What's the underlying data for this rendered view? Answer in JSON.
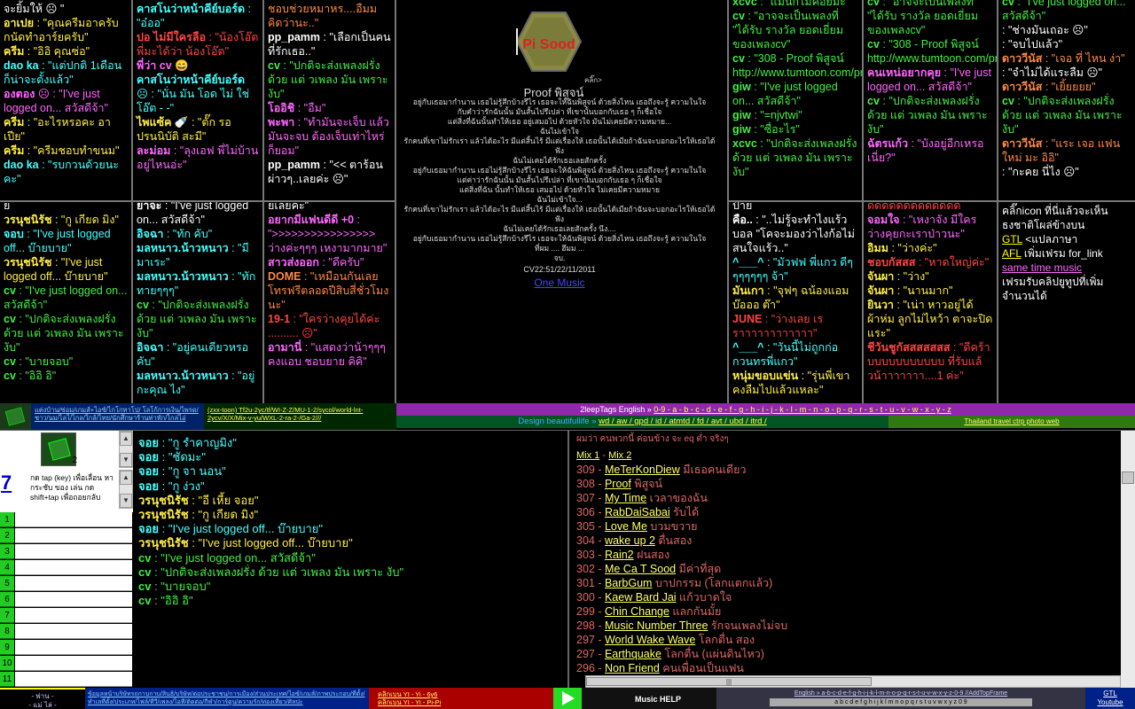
{
  "colors": {
    "green": "#44ee44",
    "pink": "#ff66ff",
    "yellow": "#ffee44",
    "cyan": "#44ffff",
    "orange": "#ff8844",
    "white": "#ffffff"
  },
  "col1": [
    {
      "n": "",
      "t": "จะยิ้มให้ ☹ \"",
      "c": "#fff"
    },
    {
      "n": "อาเปย",
      "t": " : \"คุณครีมอาครับ กนัดทำอาร์ยครับ\"",
      "c": "#ffee44"
    },
    {
      "n": "ครีม",
      "t": " : \"อิอิ คุณซ่อ\"",
      "c": "#ffee44"
    },
    {
      "n": "dao ka",
      "t": " : \"แต่ปกติ 1เดือนก็น่าจะตั้งแล้ว\"",
      "c": "#44ffff"
    },
    {
      "n": "องตอง",
      "t": " ☹ : \"I've just logged on... สวัสดีจ้า\"",
      "c": "#ff66ff"
    },
    {
      "n": "ครีม",
      "t": " : \"อะไรหรอคะ อาเปีย\"",
      "c": "#ffee44"
    },
    {
      "n": "ครีม",
      "t": " : \"ครีมชอบทำขนม\"",
      "c": "#ffee44"
    },
    {
      "n": "dao ka",
      "t": " : \"รบกวนด้วยนะคะ\"",
      "c": "#44ffff"
    }
  ],
  "col2": [
    {
      "n": "คาสโนว่าหน้าคีย์บอร์ด",
      "t": " : \"อ๋ออ\"",
      "c": "#44ffff"
    },
    {
      "n": "ปอ ไม่มีใครลือ",
      "t": " : \"น้องโอ๊ต พี่มะได้ว่า น้องโอ๊ต\"",
      "c": "#ff4444"
    },
    {
      "n": "พี่ว่า cv",
      "t": " 😄",
      "c": "#ff66ff"
    },
    {
      "n": "คาสโนว่าหน้าคีย์บอร์ด",
      "t": " ☹ : \"นั่น มัน โอด ไม่ ใช่ โอ๊ต - -\"",
      "c": "#44ffff"
    },
    {
      "n": "ไพแซ้ค",
      "t": " 🍼 : \"ตั๊ก รอ ปรนนิบัติ สะมี\"",
      "c": "#ffee44"
    },
    {
      "n": "ละม่อม",
      "t": " : \"ลุงเอฟ พี่ไม่บ้านอยู่ไหนอ่ะ\"",
      "c": "#ff66ff"
    }
  ],
  "col3": [
    {
      "n": "",
      "t": "ชอบช่วยหมาหร....อืมมคิดว่านะ..\"",
      "c": "#ff8844"
    },
    {
      "n": "pp_pamm",
      "t": " : \"เลือกเป็นคนที่รักเธอ..\"",
      "c": "#fff"
    },
    {
      "n": "cv",
      "t": " : \"ปกติจะส่งเพลงฝรั่ง ด้วย แต่ วเพลง มัน เพราะ งับ\"",
      "c": "#44ee44"
    },
    {
      "n": "โออิชิ",
      "t": " : \"อืม\"",
      "c": "#ff66ff"
    },
    {
      "n": "พะพา",
      "t": " : \"ทำมันจะเจ็บ แล้วมันจะจบ ต้องเจ็บเท่าไหร่ก็ยอม\"",
      "c": "#ff66ff"
    },
    {
      "n": "pp_pamm",
      "t": " : \"<< ตาร้อนผ่าวๆ..เลยค่ะ ☹\"",
      "c": "#fff"
    }
  ],
  "col7": [
    {
      "n": "xcvc",
      "t": " : \"แมนก็ไม่ค่อยมะ\"",
      "c": "#44ee44"
    },
    {
      "n": "cv",
      "t": " : \"อาจจะเป็นเพลงที่ \"ได้รับ รางวัล ยอดเยี่ยม ของเพลงcv\"",
      "c": "#44ee44"
    },
    {
      "n": "cv",
      "t": " : \"308 - Proof พิสูจน์ http://www.tumtoon.com/proof.html\"",
      "c": "#44ee44"
    },
    {
      "n": "giw",
      "t": " : \"I've just logged on... สวัสดีจ้า\"",
      "c": "#44ee44"
    },
    {
      "n": "giw",
      "t": " : \"=njvtwi\"",
      "c": "#44ee44"
    },
    {
      "n": "giw",
      "t": " : \"ซื่อะไร\"",
      "c": "#44ee44"
    },
    {
      "n": "xcvc",
      "t": " : \"ปกติจะส่งเพลงฝรั่ง ด้วย แต่ วเพลง มัน เพราะ งับ\"",
      "c": "#44ee44"
    }
  ],
  "col8": [
    {
      "n": "cv",
      "t": " : \"อาจจะเป็นเพลงที่ \"ได้รับ รางวัล ยอดเยี่ยม ของเพลงcv\"",
      "c": "#44ee44"
    },
    {
      "n": "cv",
      "t": " : \"308 - Proof พิสูจน์ http://www.tumtoon.com/proof.html\"",
      "c": "#44ee44"
    },
    {
      "n": "คนเหน่อยากคุย",
      "t": " : \"I've just logged on... สวัสดีจ้า\"",
      "c": "#ff66ff"
    },
    {
      "n": "cv",
      "t": " : \"ปกติจะส่งเพลงฝรั่ง ด้วย แต่ วเพลง มัน เพราะ งับ\"",
      "c": "#44ee44"
    },
    {
      "n": "ฉัตรแก้ว",
      "t": " : \"บังอยู่อีกเหรอเนี่ย?\"",
      "c": "#ff66ff"
    }
  ],
  "col9": [
    {
      "n": "cv",
      "t": " : \"I've just logged on... สวัสดีจ้า\"",
      "c": "#44ee44"
    },
    {
      "n": "",
      "t": ": \"ช่างมันเถอะ ☹\"",
      "c": "#fff"
    },
    {
      "n": "",
      "t": ": \"จบไปแล้ว\"",
      "c": "#fff"
    },
    {
      "n": "ดาววีนัส",
      "t": " : \"เจอ ที่ ไหน ง่า\"",
      "c": "#ff8844"
    },
    {
      "n": "",
      "t": ": \"จำไม่ได้แระลืม ☹\"",
      "c": "#fff"
    },
    {
      "n": "ดาววีนัส",
      "t": " : \"เยิ้ยยยย\"",
      "c": "#ff8844"
    },
    {
      "n": "cv",
      "t": " : \"ปกติจะส่งเพลงฝรั่ง ด้วย แต่ วเพลง มัน เพราะ งับ\"",
      "c": "#44ee44"
    },
    {
      "n": "ดาววีนัส",
      "t": " : \"แระ เจอ แฟนใหม่ มะ อิอิ\"",
      "c": "#ff8844"
    },
    {
      "n": "",
      "t": ": \"กะคย นี่ไง ☹\"",
      "c": "#fff"
    }
  ],
  "col1b": [
    {
      "n": "",
      "t": "ย",
      "c": "#fff"
    },
    {
      "n": "วรนุชนิรัช",
      "t": " : \"กู เกียด มิง\"",
      "c": "#ffee44"
    },
    {
      "n": "จอบ",
      "t": " : \"I've just logged off... บ๊ายบาย\"",
      "c": "#44ffff"
    },
    {
      "n": "วรนุชนิรัช",
      "t": " : \"I've just logged off... บ๊ายบาย\"",
      "c": "#ffee44"
    },
    {
      "n": "cv",
      "t": " : \"I've just logged on... สวัสดีจ้า\"",
      "c": "#44ee44"
    },
    {
      "n": "cv",
      "t": " : \"ปกติจะส่งเพลงฝรั่ง ด้วย แต่ วเพลง มัน เพราะ งับ\"",
      "c": "#44ee44"
    },
    {
      "n": "cv",
      "t": " : \"บายจอบ\"",
      "c": "#44ee44"
    },
    {
      "n": "cv",
      "t": " : \"อิอิ อิ\"",
      "c": "#44ee44"
    }
  ],
  "col2b": [
    {
      "n": "ยาจะ",
      "t": " : \"I've just logged on... สวัสดีจ้า\"",
      "c": "#fff"
    },
    {
      "n": "อิจฉา",
      "t": " : \"ทัก คับ\"",
      "c": "#44ffff"
    },
    {
      "n": "มลหนาว.น้าวหนาว",
      "t": " : \"มีมาเระ\"",
      "c": "#44ffff"
    },
    {
      "n": "มลหนาว.น้าวหนาว",
      "t": " : \"ทักทายๆๆๆ\"",
      "c": "#44ffff"
    },
    {
      "n": "cv",
      "t": " : \"ปกติจะส่งเพลงฝรั่ง ด้วย แต่ วเพลง มัน เพราะ งับ\"",
      "c": "#44ee44"
    },
    {
      "n": "อิจฉา",
      "t": " : \"อยู่คนเดียวหรอคับ\"",
      "c": "#44ffff"
    },
    {
      "n": "มลหนาว.น้าวหนาว",
      "t": " : \"อยู่ กะคุณ ไง\"",
      "c": "#44ffff"
    }
  ],
  "col3b": [
    {
      "n": "",
      "t": "ยเลยค่ะ\"",
      "c": "#fff"
    },
    {
      "n": "อยากมีแฟนดีดี +0",
      "t": " : \">>>>>>>>>>>>>>>> ว่างค่ะๆๆๆ เหงามากมาย\"",
      "c": "#ff66ff"
    },
    {
      "n": "สาวส่งออก",
      "t": " : \"ดีครับ\"",
      "c": "#ff66ff"
    },
    {
      "n": "DOME",
      "t": " : \"เหมือนกันเลย โทรฟรีตลอดปีสิบสี่ชั่วโมงนะ\"",
      "c": "#ff8844"
    },
    {
      "n": "19-1",
      "t": " : \"ใครว่างคุยได้ค่ะ .......... ☹\"",
      "c": "#ff4444"
    },
    {
      "n": "อามานี่",
      "t": " : \"แสดงว่าน้าๆๆๆ คงแอบ ชอบยาย คิคิ\"",
      "c": "#ff66ff"
    }
  ],
  "col7b": [
    {
      "n": "",
      "t": "ป้าย",
      "c": "#fff"
    },
    {
      "n": "คือ..",
      "t": " : \"..ไม่รู้จะทำไงแร้วบอล \"โคจะมองว่าไงก้อไม่สนใจแร้ว..\"",
      "c": "#fff"
    },
    {
      "n": "^___^",
      "t": " : \"มัวฟฟ พี่แกว ดีๆๆๆๆๆๆๆ จ้า\"",
      "c": "#44ffff"
    },
    {
      "n": "มันเกา",
      "t": " : \"จุฟๆ ฉน้องแอม บ๊อออ ต๊า\"",
      "c": "#ffee44"
    },
    {
      "n": "JUNE",
      "t": " : \"ว่างเลย เรราาาาาาาาาาาา\"",
      "c": "#ff4444"
    },
    {
      "n": "^___^",
      "t": " : \"วันนี้ไม่ถูกก่อ กวนทรพี่แกว\"",
      "c": "#44ffff"
    },
    {
      "n": "หนุ่มขอบแข่น",
      "t": " : \"รุ่นพี่เขา คงลืมไปแล้วแหละ\"",
      "c": "#ffee44"
    }
  ],
  "col8b": [
    {
      "n": "",
      "t": "ดดดดดดดดดดดดด",
      "c": "#ff4444"
    },
    {
      "n": "จอมใจ",
      "t": " : \"เหงาจัง มีใครว่างคุยกะเราป่าวนะ\"",
      "c": "#ff66ff"
    },
    {
      "n": "อิมม",
      "t": " : \"ว่างค่ะ\"",
      "c": "#ffee44"
    },
    {
      "n": "ชอบกัสสส",
      "t": " : \"หาดใหญ่ค่ะ\"",
      "c": "#ff4444"
    },
    {
      "n": "จันผา",
      "t": " : \"ว่าง\"",
      "c": "#ffee44"
    },
    {
      "n": "จันผา",
      "t": " : \"นานมาก\"",
      "c": "#ffee44"
    },
    {
      "n": "ยินวา",
      "t": " : \"เน่า หาวอยู่ได้ผ้าห่ม ลูกไม่ไหว้า ตาจะปิดแระ\"",
      "c": "#ffee44"
    },
    {
      "n": "ชีวันชูกัสสสสสสส",
      "t": " : \"ดีคร้าบบบบบบบบบบบ ที่รับแล้วน้าาาาาาา....1 ค่ะ\"",
      "c": "#ff4444"
    }
  ],
  "col9b": [
    {
      "t": "คลิ๊กicon ที่นี่แล้วจะเห็นธงชาติโผล่ข้างบน"
    },
    {
      "t": "GTL",
      "link": true,
      "after": " <แปลภาษา"
    },
    {
      "t": "AFL",
      "link": true,
      "after": " เพิ่มเฟรม for_link"
    },
    {
      "t": "same time music",
      "link": true,
      "linkcolor": "#ff66ff",
      "after": ""
    },
    {
      "t": "เฟรมรับคลิปยูทูปที่เพิ่มจำนวนได้",
      "after": ""
    }
  ],
  "center": {
    "logo": "Pi Sood",
    "click": "คลิ๊ก>",
    "song_title": "Proof พิสูจน์",
    "lyrics": [
      "อยู่กับเธอมากำนาน เธอไม่รู้สึกบ้างรึไร เธอจะให้ฉันพิสูจน์ ด้วยสิ่งไหน เธอถึงจะรู้ ความในใจ",
      "กับคำว่ารักฉันนั้น มันสั้นไปรึเปล่า ที่เขานั้นบอกกับเธอ ๆ ก็เชื่อใจ",
      "แต่สิ่งที่ฉันนั้นทำให้เธอ อยู่เสมอไป ด้วยหัวใจ มันไม่เคยมีความหมาย...",
      "ฉันไม่เข้าใจ",
      "รักคนที่เขาไม่รักเรา แล้วได้อะไร มีแต่สิ้นไร้ มีแต่เรื่องให้ เธอนั้นได้เมียถ้าฉันจะบอกอะไรให้เธอได้ฟัง",
      "ฉันไม่เคยได้รักเธอเลยสักครั้ง",
      "อยู่กับเธอมากำนาน เธอไม่รู้สึกบ้างรึไร เธอจะให้ฉันพิสูจน์ ด้วยสิ่งไหน เธอถึงจะรู้ ความในใจ",
      "แต่ค่าว่ารักฉันนั้น มันสั้นไปรึเปล่า ที่เขานั้นบอกกับเธอ ๆ ก็เชื่อใจ",
      "แต่สิ่งที่ฉัน นั้นทำให้เธอ เสมอไป ด้วยหัวใจ ไม่เคยมีความหมาย",
      "ฉันไม่เข้าใจ...",
      "รักคนที่เขาไม่รักเรา แล้วได้อะไร มีแต่สิ้นไร้ มีแต่เรื่องให้ เธอนั้นได้เมียถ้าฉันจะบอกอะไรให้เธอได้ฟัง",
      "ฉันไม่เคยได้รักเธอเลยสักครั้ง นึง....",
      "อยู่กับเธอมากำนาน เธอไม่รู้สึกบ้างรึไร เธอจะให้ฉันพิสูจน์ ด้วยสิ่งไหน เธอถึงจะรู้ ความในใจ",
      "ที่ผม .... ฮึมม ...",
      "จบ."
    ],
    "timestamp": "CV22:51/22/11/2011",
    "link": "One Music"
  },
  "navbar": {
    "left_links": "แต่งบ้าน/ซ่อม/เกมส์+ไอซ์/ไกโกทาโป/ โลโก้การเงิน/ไพรด/ ชาว/นม/ไลไ/ไกล/ใกล้/ไทย/นักศึกษาร้านท่าทัก/ไกล่ไอ่",
    "mid_links": "(zxx-toon) Tf2u-2yc/tf/WI-Z-Z/MU-1-2/sycol/world-lnt-2ycv/X/X/Mix-v-yu/WXL-2-ra-2-/Ga-2///",
    "tags_label": "2leepTags English » ",
    "tags_letters": "0-9 - a - b - c - d - e - f - g - h - i - j - k - l - m - n - o - p - q - r - s - t - u - v - w - x - y - z",
    "design": "Design beautifullife » ",
    "design_links": "wd / aw / gpd / id / atmtd / fd / avt / ubd / itrd /",
    "travel": "Thailand travel ctrp photo web"
  },
  "mini": {
    "counter": "2",
    "big_num": "7",
    "desc": "กด tap (key) เพื่อเลื่อน หา กระชับ ของ เล่น กด shift+tap เพื่อถอยกลับ"
  },
  "rownums": [
    "1",
    "2",
    "3",
    "4",
    "5",
    "6",
    "7",
    "8",
    "9",
    "10",
    "11"
  ],
  "chat2": [
    {
      "n": "จอย",
      "t": " : \"กู รำคาญมิง\"",
      "c": "#44ffff"
    },
    {
      "n": "จอย",
      "t": " : \"ชัดมะ\"",
      "c": "#44ffff"
    },
    {
      "n": "จอย",
      "t": " : \"กู จา นอน\"",
      "c": "#44ffff"
    },
    {
      "n": "จอย",
      "t": " : \"กู ง่วง\"",
      "c": "#44ffff"
    },
    {
      "n": "วรนุชนิรัช",
      "t": " : \"อี เหี้ย จอย\"",
      "c": "#ffee44"
    },
    {
      "n": "วรนุชนิรัช",
      "t": " : \"กู เกียด มิง\"",
      "c": "#ffee44"
    },
    {
      "n": "จอย",
      "t": " : \"I've just logged off... บ๊ายบาย\"",
      "c": "#44ffff"
    },
    {
      "n": "วรนุชนิรัช",
      "t": " : \"I've just logged off... บ๊ายบาย\"",
      "c": "#ffee44"
    },
    {
      "n": "cv",
      "t": " : \"I've just logged on... สวัสดีจ้า\"",
      "c": "#44ee44"
    },
    {
      "n": "cv",
      "t": " : \"ปกติจะส่งเพลงฝรั่ง ด้วย แต่ วเพลง มัน เพราะ งับ\"",
      "c": "#44ee44"
    },
    {
      "n": "cv",
      "t": " : \"บายจอบ\"",
      "c": "#44ee44"
    },
    {
      "n": "cv",
      "t": " : \"อิอิ อิ\"",
      "c": "#44ee44"
    }
  ],
  "songlist": {
    "header": "ผมว่า คนพวกนี้ ค่อนข้าง จะ eq ต่ำ จริงๆ",
    "mix": [
      "Mix 1",
      "Mix 2"
    ],
    "items": [
      {
        "n": "309",
        "t": "MeTerKonDiew",
        "d": "มีเธอคนเดียว"
      },
      {
        "n": "308",
        "t": "Proof",
        "d": "พิสูจน์"
      },
      {
        "n": "307",
        "t": "My Time",
        "d": "เวลาของฉัน"
      },
      {
        "n": "306",
        "t": "RabDaiSabai",
        "d": "รับได้"
      },
      {
        "n": "305",
        "t": "Love Me",
        "d": "บวมขวาย"
      },
      {
        "n": "304",
        "t": "wake up 2",
        "d": "ตื่นสอง"
      },
      {
        "n": "303",
        "t": "Rain2",
        "d": "ฝนสอง"
      },
      {
        "n": "302",
        "t": "Me Ca T Sood",
        "d": "มีค่าที่สุด"
      },
      {
        "n": "301",
        "t": "BarbGum",
        "d": "บาปกรรม (โลกแตกแล้ว)"
      },
      {
        "n": "300",
        "t": "Kaew Bard Jai",
        "d": "แก้วบาดใจ"
      },
      {
        "n": "299",
        "t": "Chin Change",
        "d": "แลกกันมั้ย"
      },
      {
        "n": "298",
        "t": "Music Number Three",
        "d": "รักจนเพลงไม่จบ"
      },
      {
        "n": "297",
        "t": "World Wake Wave",
        "d": "โลกตื่น สอง"
      },
      {
        "n": "297",
        "t": "Earthquake",
        "d": "โลกตื่น (แผ่นดินไหว)"
      },
      {
        "n": "296",
        "t": "Non Friend",
        "d": "คนเพื่อนเป็นแฟน"
      }
    ]
  },
  "bottom": {
    "b1": "- พ่าน -\n- แม่ ไล่ -",
    "b2": "ข้อมูลหน้าบริษัทรถกาบกาบ/สินธิ/บริษัท/ต่อประชาชน/การเมือง/ส่วนประเทศ/ไอซ์/เกมส์/ภาพประกอบ/ที่ตั้ง/ทำเลที่ตั้ง/ประเภท/ไฟล์/ทีวี/เพลง/ไอที/ติดต่อ/กีฬา/การ์ตูน/ความรัก/ท่องเที่ยว/ศิลปะ",
    "b3a": "คลิกเบน YI - Yi - 6y6",
    "b3b": "คลิกเบน YI - Yi - Pi-Pi",
    "b4": "Music HELP",
    "b5a": "English » a-b-c-d-e-f-g-h-i-j-k-l-m-n-o-p-q-r-s-t-u-v-w-x-y-z-0-9 //AddTopFrame",
    "b5b": "a b c d e f g h i j k l m n o p q r s t u v w x y z 0 9",
    "b6": "GTL\nYoutube"
  }
}
